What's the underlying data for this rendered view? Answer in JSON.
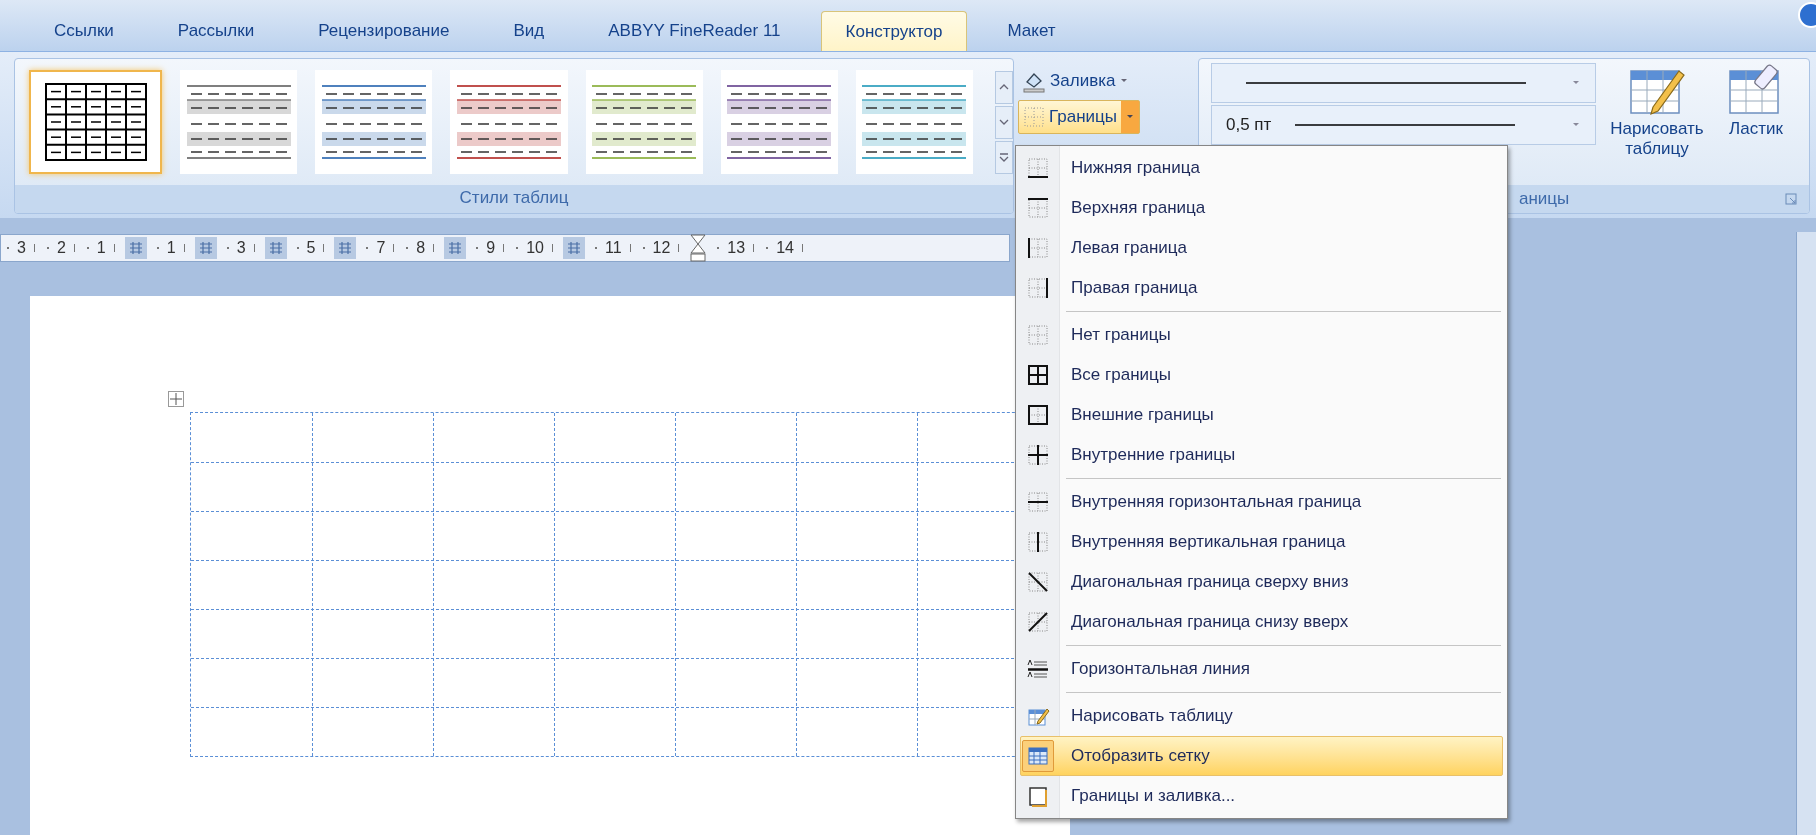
{
  "tabs": [
    {
      "label": "Ссылки",
      "selected": false
    },
    {
      "label": "Рассылки",
      "selected": false
    },
    {
      "label": "Рецензирование",
      "selected": false
    },
    {
      "label": "Вид",
      "selected": false
    },
    {
      "label": "ABBYY FineReader 11",
      "selected": false
    },
    {
      "label": "Конструктор",
      "selected": true
    },
    {
      "label": "Макет",
      "selected": false
    }
  ],
  "table_styles": {
    "label": "Стили таблиц",
    "styles": [
      {
        "kind": "grid",
        "color": "#000000",
        "selected": true
      },
      {
        "kind": "banded",
        "color": "#7f7f7f",
        "selected": false
      },
      {
        "kind": "banded",
        "color": "#4f81bd",
        "selected": false
      },
      {
        "kind": "banded",
        "color": "#c0504d",
        "selected": false
      },
      {
        "kind": "banded",
        "color": "#9bbb59",
        "selected": false
      },
      {
        "kind": "banded",
        "color": "#8064a2",
        "selected": false
      },
      {
        "kind": "banded",
        "color": "#4bacc6",
        "selected": false
      }
    ]
  },
  "shading_button": {
    "label": "Заливка"
  },
  "borders_button": {
    "label": "Границы",
    "expanded": true
  },
  "draw_borders": {
    "pen_weight": "0,5 пт",
    "draw_table": "Нарисовать таблицу",
    "eraser": "Ластик",
    "group_label": "аницы"
  },
  "ruler": [
    {
      "kind": "number",
      "label": "3"
    },
    {
      "kind": "number",
      "label": "2"
    },
    {
      "kind": "number",
      "label": "1"
    },
    {
      "kind": "marker"
    },
    {
      "kind": "number",
      "label": "1"
    },
    {
      "kind": "marker"
    },
    {
      "kind": "number",
      "label": "3"
    },
    {
      "kind": "marker"
    },
    {
      "kind": "number",
      "label": "5"
    },
    {
      "kind": "marker"
    },
    {
      "kind": "number",
      "label": "7"
    },
    {
      "kind": "number",
      "label": "8"
    },
    {
      "kind": "marker"
    },
    {
      "kind": "number",
      "label": "9"
    },
    {
      "kind": "number",
      "label": "10"
    },
    {
      "kind": "marker"
    },
    {
      "kind": "number",
      "label": "11"
    },
    {
      "kind": "number",
      "label": "12"
    },
    {
      "kind": "indent"
    },
    {
      "kind": "number",
      "label": "13"
    },
    {
      "kind": "number",
      "label": "14"
    }
  ],
  "borders_menu": [
    [
      {
        "kind": "bottom",
        "label": "Нижняя граница",
        "selected": false
      },
      {
        "kind": "top",
        "label": "Верхняя граница",
        "selected": false
      },
      {
        "kind": "left",
        "label": "Левая граница",
        "selected": false
      },
      {
        "kind": "right",
        "label": "Правая граница",
        "selected": false
      }
    ],
    [
      {
        "kind": "none",
        "label": "Нет границы",
        "selected": false
      },
      {
        "kind": "all",
        "label": "Все границы",
        "selected": false
      },
      {
        "kind": "outside",
        "label": "Внешние границы",
        "selected": false
      },
      {
        "kind": "inside",
        "label": "Внутренние границы",
        "selected": false
      }
    ],
    [
      {
        "kind": "inside_h",
        "label": "Внутренняя горизонтальная граница",
        "selected": false
      },
      {
        "kind": "inside_v",
        "label": "Внутренняя вертикальная граница",
        "selected": false
      },
      {
        "kind": "diag_down",
        "label": "Диагональная граница сверху вниз",
        "selected": false
      },
      {
        "kind": "diag_up",
        "label": "Диагональная граница снизу вверх",
        "selected": false
      }
    ],
    [
      {
        "kind": "hline",
        "label": "Горизонтальная линия",
        "selected": false
      }
    ],
    [
      {
        "kind": "draw",
        "label": "Нарисовать таблицу",
        "selected": false
      },
      {
        "kind": "gridlines",
        "label": "Отобразить сетку",
        "selected": true
      },
      {
        "kind": "dialog",
        "label": "Границы и заливка...",
        "selected": false
      }
    ]
  ]
}
